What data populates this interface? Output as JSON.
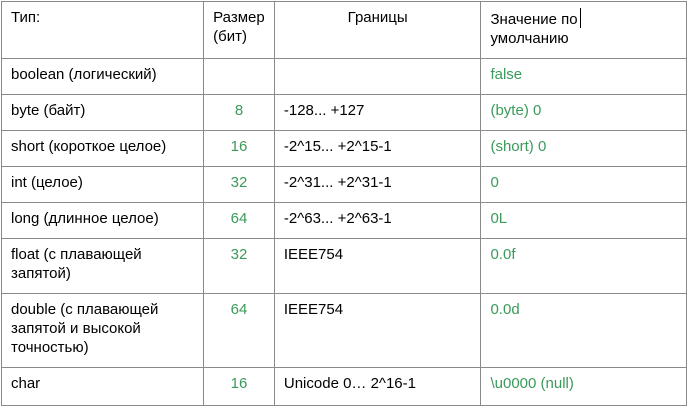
{
  "headers": {
    "type": "Тип:",
    "size": "Размер (бит)",
    "bounds": "Границы",
    "default": "Значение по умолчанию"
  },
  "rows": [
    {
      "type": "boolean (логический)",
      "size": "",
      "bounds": "",
      "default": "false"
    },
    {
      "type": "byte (байт)",
      "size": "8",
      "bounds": "-128... +127",
      "default": "(byte) 0"
    },
    {
      "type": "short (короткое целое)",
      "size": "16",
      "bounds": "-2^15... +2^15-1",
      "default": "(short) 0"
    },
    {
      "type": "int (целое)",
      "size": "32",
      "bounds": "-2^31... +2^31-1",
      "default": "0"
    },
    {
      "type": "long (длинное целое)",
      "size": "64",
      "bounds": "-2^63... +2^63-1",
      "default": "0L"
    },
    {
      "type": "float (с плавающей запятой)",
      "size": "32",
      "bounds": "IEEE754",
      "default": "0.0f"
    },
    {
      "type": "double (с плавающей запятой и высокой точностью)",
      "size": "64",
      "bounds": "IEEE754",
      "default": "0.0d"
    },
    {
      "type": "char",
      "size": "16",
      "bounds": "Unicode 0… 2^16-1",
      "default": "\\u0000 (null)"
    }
  ],
  "colors": {
    "value_green": "#3a9a5a",
    "border": "#8a8a8a"
  }
}
